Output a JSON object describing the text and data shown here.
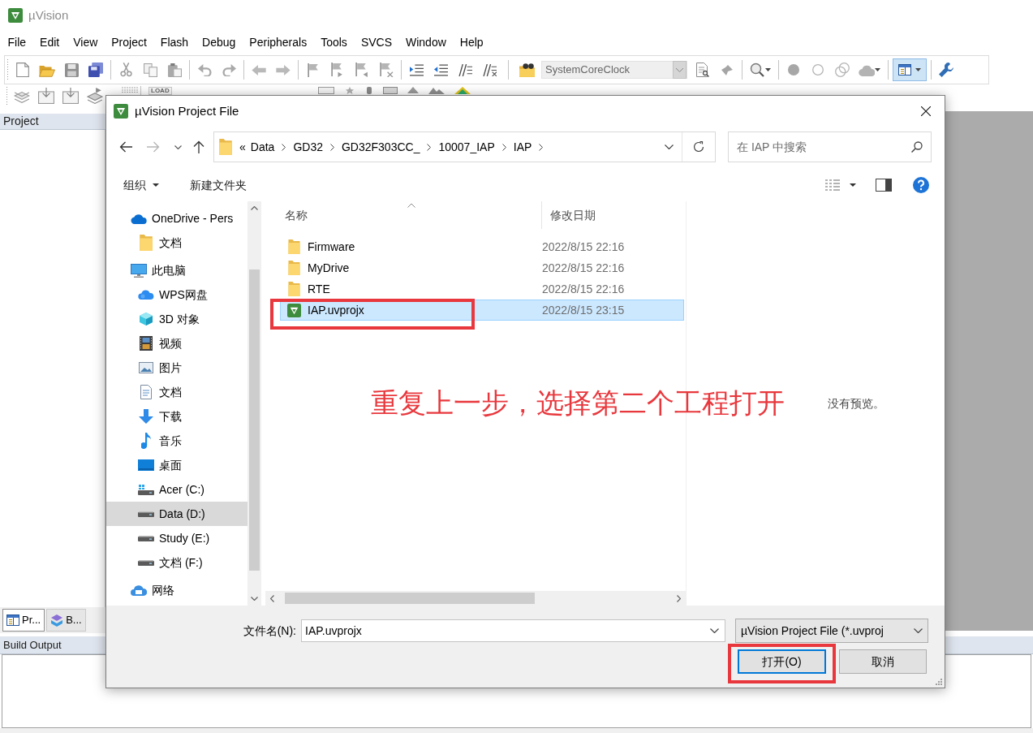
{
  "app": {
    "title": "µVision",
    "menu": [
      "File",
      "Edit",
      "View",
      "Project",
      "Flash",
      "Debug",
      "Peripherals",
      "Tools",
      "SVCS",
      "Window",
      "Help"
    ],
    "toolbar": {
      "find_text": "SystemCoreClock",
      "window_button_pressed": true,
      "load_label": "LOAD"
    },
    "project_pane": {
      "title": "Project",
      "tabs": [
        {
          "kind": "project",
          "label": "Pr...",
          "selected": true
        },
        {
          "kind": "books",
          "label": "B...",
          "selected": false
        }
      ]
    },
    "build_output": {
      "title": "Build Output"
    }
  },
  "dialog": {
    "title": "µVision Project File",
    "address": {
      "overflow": "«",
      "path": [
        "Data",
        "GD32",
        "GD32F303CC_",
        "10007_IAP",
        "IAP"
      ]
    },
    "search": {
      "placeholder": "在 IAP 中搜索"
    },
    "commands": [
      {
        "label": "组织",
        "menu": true
      },
      {
        "label": "新建文件夹",
        "menu": false
      }
    ],
    "nav": [
      {
        "kind": "cloud",
        "label": "OneDrive - Pers",
        "selected": false,
        "children": [
          {
            "kind": "folder",
            "label": "文档",
            "selected": false
          }
        ]
      },
      {
        "kind": "computer",
        "label": "此电脑",
        "selected": false,
        "children": [
          {
            "kind": "cloud_drive",
            "label": "WPS网盘",
            "selected": false
          },
          {
            "kind": "objects_3d",
            "label": "3D 对象",
            "selected": false
          },
          {
            "kind": "videos",
            "label": "视频",
            "selected": false
          },
          {
            "kind": "pictures",
            "label": "图片",
            "selected": false
          },
          {
            "kind": "documents",
            "label": "文档",
            "selected": false
          },
          {
            "kind": "downloads",
            "label": "下载",
            "selected": false
          },
          {
            "kind": "music",
            "label": "音乐",
            "selected": false
          },
          {
            "kind": "desktop",
            "label": "桌面",
            "selected": false
          },
          {
            "kind": "system_drive",
            "label": "Acer (C:)",
            "selected": false
          },
          {
            "kind": "drive",
            "label": "Data (D:)",
            "selected": true
          },
          {
            "kind": "drive",
            "label": "Study (E:)",
            "selected": false
          },
          {
            "kind": "drive",
            "label": "文档 (F:)",
            "selected": false
          }
        ]
      },
      {
        "kind": "network",
        "label": "网络",
        "selected": false
      }
    ],
    "columns": [
      {
        "label": "名称",
        "sorted": true
      },
      {
        "label": "修改日期",
        "sorted": false
      }
    ],
    "files": [
      {
        "kind": "folder",
        "name": "Firmware",
        "modified": "2022/8/15 22:16",
        "selected": false,
        "highlighted": false
      },
      {
        "kind": "folder",
        "name": "MyDrive",
        "modified": "2022/8/15 22:16",
        "selected": false,
        "highlighted": false
      },
      {
        "kind": "folder",
        "name": "RTE",
        "modified": "2022/8/15 22:16",
        "selected": false,
        "highlighted": false
      },
      {
        "kind": "project",
        "name": "IAP.uvprojx",
        "modified": "2022/8/15 23:15",
        "selected": true,
        "highlighted": true
      }
    ],
    "preview": "没有预览。",
    "file_name": {
      "label": "文件名(N):",
      "value": "IAP.uvprojx"
    },
    "file_type": {
      "value": "µVision Project File (*.uvproj"
    },
    "buttons": [
      {
        "label": "打开(O)",
        "default": true,
        "highlighted": true
      },
      {
        "label": "取消",
        "default": false,
        "highlighted": false
      }
    ]
  },
  "annotation": {
    "text": "重复上一步，选择第二个工程打开"
  }
}
